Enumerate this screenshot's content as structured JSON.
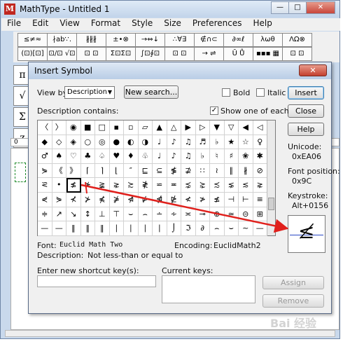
{
  "window": {
    "title": "MathType - Untitled 1",
    "app_icon": "M",
    "minimize": "—",
    "maximize": "□",
    "close": "✕"
  },
  "menu": [
    "File",
    "Edit",
    "View",
    "Format",
    "Style",
    "Size",
    "Preferences",
    "Help"
  ],
  "toolbar": {
    "row1": [
      "≤≠≈",
      "∤ab∵.",
      "∦∦∦",
      "±•⊗",
      "→⇔↓",
      "∴∀∃",
      "∉∩⊂",
      "∂∞ℓ",
      "λωθ",
      "ΛΩ⊗"
    ],
    "row2": [
      "(⊡)[⊡]",
      "⊡/⊡ √⊡",
      "⊡ ⊡",
      "Σ⊡Σ⊡",
      "∫⊡∮⊡",
      "⊡ ⊡",
      "→ ⇌",
      "Ū Ů",
      "▪▪▪ ▦",
      "⊡ ⊡"
    ]
  },
  "left_palette": [
    "π",
    "√",
    "Σ",
    "z"
  ],
  "dialog": {
    "title": "Insert Symbol",
    "view_by_label": "View by:",
    "view_by_value": "Description",
    "new_search": "New search...",
    "bold_label": "Bold",
    "italic_label": "Italic",
    "insert": "Insert",
    "close": "Close",
    "help": "Help",
    "description_contains": "Description contains:",
    "show_one_of_each": "Show one of each",
    "show_one_checked": "✓",
    "unicode_label": "Unicode:",
    "unicode_value": "0xEA06",
    "font_position_label": "Font position:",
    "font_position_value": "0x9C",
    "keystroke_label": "Keystroke:",
    "keystroke_value": "Alt+0156",
    "font_label": "Font:",
    "font_value": "Euclid Math Two",
    "encoding_label": "Encoding:",
    "encoding_value": "EuclidMath2",
    "description_label": "Description:",
    "description_value": "Not less-than or equal to",
    "shortcut_label": "Enter new shortcut key(s):",
    "current_keys_label": "Current keys:",
    "assign": "Assign",
    "remove": "Remove",
    "preview_glyph": "≰",
    "close_x": "✕"
  },
  "symbols": [
    [
      "〈",
      "〉",
      "◉",
      "■",
      "□",
      "▪",
      "▫",
      "▱",
      "▲",
      "△",
      "▶",
      "▷",
      "▼",
      "▽",
      "◀",
      "◁"
    ],
    [
      "◆",
      "◇",
      "◈",
      "○",
      "◎",
      "●",
      "◐",
      "◑",
      "♩",
      "♪",
      "♫",
      "♬",
      "♭",
      "★",
      "☆",
      "♀"
    ],
    [
      "♂",
      "♠",
      "♡",
      "♣",
      "♤",
      "♥",
      "♦",
      "♧",
      "♩",
      "♪",
      "♫",
      "♭",
      "♮",
      "♯",
      "❀",
      "✱"
    ],
    [
      "⋟",
      "《",
      "》",
      "⌈",
      "⌉",
      "⌊",
      "″",
      "⊑",
      "⊆",
      "≸",
      "⊉",
      "∷",
      "≀",
      "∥",
      "∦",
      "⊘"
    ],
    [
      "⪝",
      "•",
      "≰",
      "⊁",
      "≩",
      "⋧",
      "≿",
      "≹",
      "⋍",
      "≖",
      "⋨",
      "⋩",
      "≾",
      "⋦",
      "≲",
      "⋧"
    ],
    [
      "⋞",
      "⋟",
      "⊀",
      "⊁",
      "⋠",
      "⋡",
      "⋪",
      "⋫",
      "⋬",
      "⋭",
      "≮",
      "≯",
      "≰",
      "⊣",
      "⊢",
      "≡"
    ],
    [
      "≑",
      "↗",
      "↘",
      "↕",
      "⊥",
      "⊤",
      "⌣",
      "⌢",
      "∸",
      "∻",
      "≍",
      "⊸",
      "⊕",
      "≃",
      "⊝",
      "⊞"
    ],
    [
      "—",
      "—",
      "‖",
      "‖",
      "‖",
      "∣",
      "∣",
      "∣",
      "∣",
      "⌡",
      "ℑ",
      "∂",
      "⌢",
      "⌣",
      "~",
      "—"
    ]
  ],
  "selected_symbol": "≰",
  "ruler_mark": "0",
  "watermark": "Bai 经验"
}
